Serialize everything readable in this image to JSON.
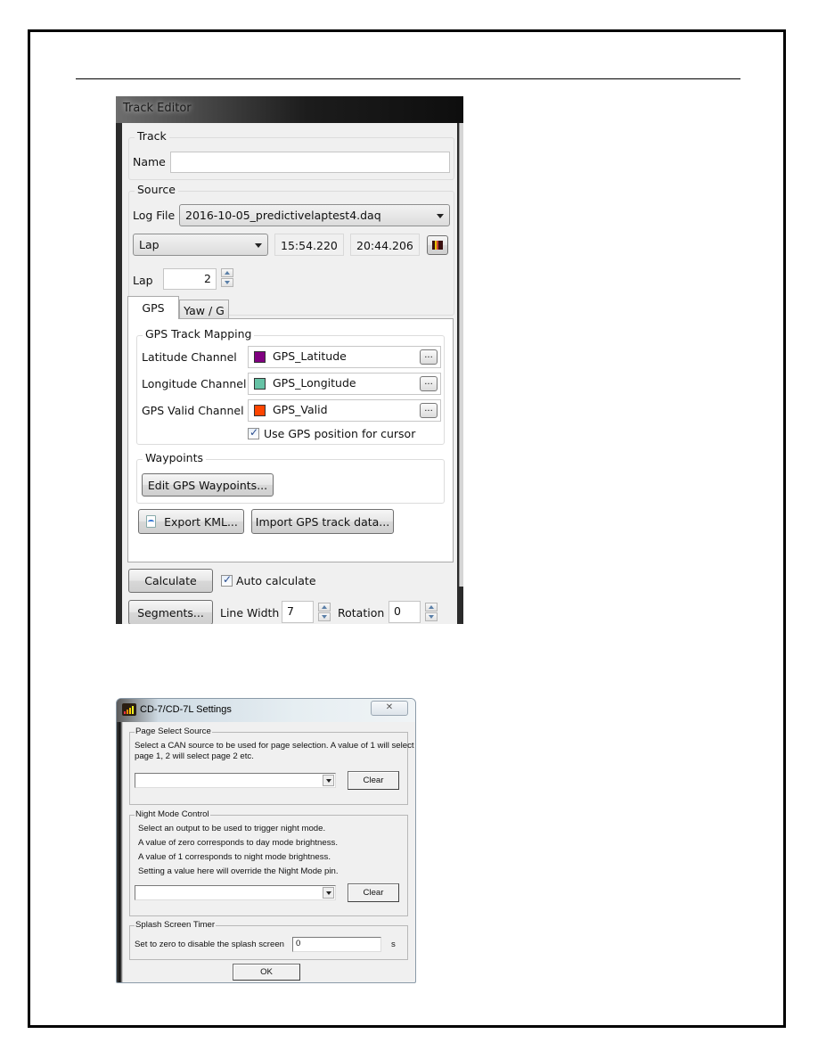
{
  "track_editor": {
    "title": "Track Editor",
    "track_group": {
      "title": "Track",
      "name_label": "Name",
      "name_value": ""
    },
    "source_group": {
      "title": "Source",
      "log_file_label": "Log File",
      "log_file_value": "2016-10-05_predictivelaptest4.daq",
      "range_type_value": "Lap",
      "start_time": "15:54.220",
      "end_time": "20:44.206",
      "lap_label": "Lap",
      "lap_value": "2"
    },
    "tabs": [
      {
        "label": "GPS",
        "active": true
      },
      {
        "label": "Yaw / G",
        "active": false
      }
    ],
    "gps_mapping": {
      "title": "GPS Track Mapping",
      "channels": [
        {
          "label": "Latitude Channel",
          "value": "GPS_Latitude",
          "color": "#800080"
        },
        {
          "label": "Longitude Channel",
          "value": "GPS_Longitude",
          "color": "#66c2a5"
        },
        {
          "label": "GPS Valid Channel",
          "value": "GPS_Valid",
          "color": "#ff4500"
        }
      ],
      "browse_label": "...",
      "use_gps_cursor_label": "Use GPS position for cursor",
      "use_gps_cursor_checked": true
    },
    "waypoints": {
      "title": "Waypoints",
      "edit_button": "Edit GPS Waypoints..."
    },
    "export_kml_button": "Export KML...",
    "import_gps_button": "Import GPS track data...",
    "calculate_button": "Calculate",
    "auto_calculate_label": "Auto calculate",
    "auto_calculate_checked": true,
    "segments_button": "Segments...",
    "line_width_label": "Line Width",
    "line_width_value": "7",
    "rotation_label": "Rotation",
    "rotation_value": "0"
  },
  "cd7_settings": {
    "title": "CD-7/CD-7L Settings",
    "close_glyph": "✕",
    "page_select": {
      "title": "Page Select Source",
      "description_line1": "Select a CAN source to be used for page selection. A value of 1 will select",
      "description_line2": "page 1, 2 will select page 2  etc.",
      "combo_value": "",
      "clear_button": "Clear"
    },
    "night_mode": {
      "title": "Night Mode Control",
      "lines": [
        "Select an output to be used to trigger night mode.",
        "A value of zero corresponds to day mode brightness.",
        "A value of 1 corresponds to night mode brightness.",
        "Setting a value here will override the Night Mode pin."
      ],
      "combo_value": "",
      "clear_button": "Clear"
    },
    "splash": {
      "title": "Splash Screen Timer",
      "label": "Set to zero to disable the splash screen",
      "value": "0",
      "unit": "s"
    },
    "ok_button": "OK"
  }
}
